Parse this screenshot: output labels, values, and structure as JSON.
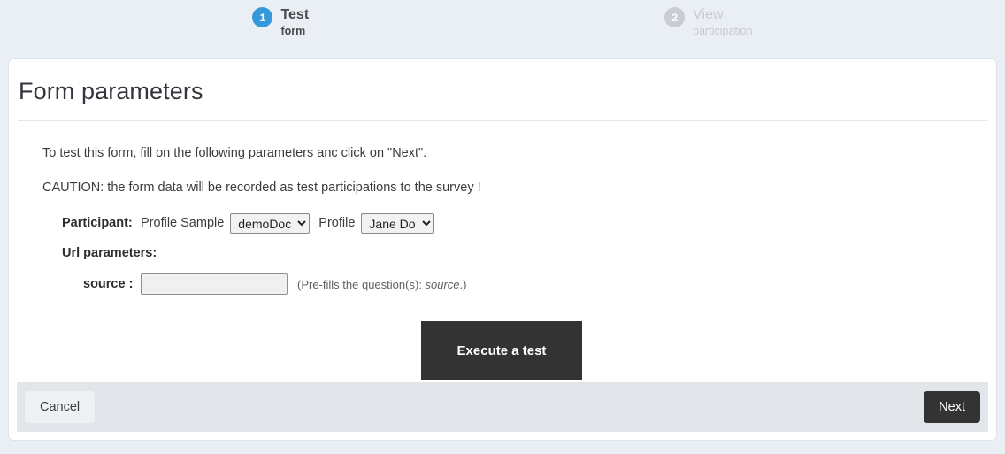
{
  "stepper": {
    "steps": [
      {
        "number": "1",
        "title": "Test",
        "subtitle": "form",
        "state": "active"
      },
      {
        "number": "2",
        "title": "View",
        "subtitle": "participation",
        "state": "inactive"
      }
    ],
    "active_color": "#3498db",
    "inactive_color": "#c9cdd3"
  },
  "card": {
    "title": "Form parameters",
    "intro_1": "To test this form, fill on the following parameters anc click on \"Next\".",
    "intro_2": "CAUTION: the form data will be recorded as test participations to the survey !"
  },
  "form": {
    "participant_label": "Participant:",
    "profile_sample_label": "Profile Sample",
    "profile_sample_value": "demoDoc",
    "profile_sample_options": [
      "demoDoc"
    ],
    "profile_label": "Profile",
    "profile_value": "Jane Doe",
    "profile_options": [
      "Jane Doe"
    ],
    "url_parameters_label": "Url parameters:",
    "source_label": "source :",
    "source_value": "",
    "source_placeholder": "",
    "source_hint_prefix": "(Pre-fills the question(s): ",
    "source_hint_italic": "source",
    "source_hint_suffix": ".)"
  },
  "actions": {
    "execute_label": "Execute a test",
    "execute_bg": "#333333",
    "cancel_label": "Cancel",
    "next_label": "Next",
    "next_bg": "#333333"
  }
}
